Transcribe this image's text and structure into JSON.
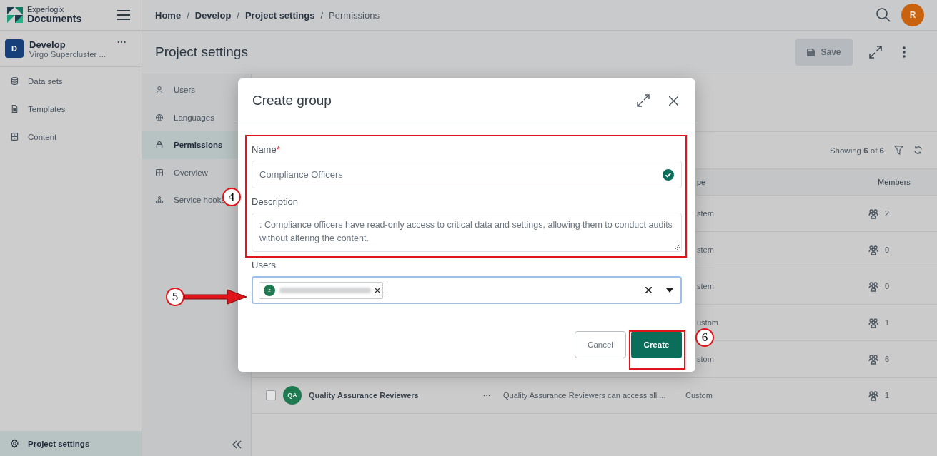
{
  "sidebar": {
    "brand_small": "Experlogix",
    "brand": "Documents",
    "project": {
      "initial": "D",
      "name": "Develop",
      "subtitle": "Virgo Supercluster ...",
      "more": "···"
    },
    "items": [
      {
        "label": "Data sets",
        "selected": false
      },
      {
        "label": "Templates",
        "selected": false
      },
      {
        "label": "Content",
        "selected": false
      }
    ],
    "footer": {
      "label": "Project settings",
      "selected": true
    }
  },
  "breadcrumb": {
    "items": [
      "Home",
      "Develop",
      "Project settings",
      "Permissions"
    ],
    "separator": "/"
  },
  "user_avatar": "R",
  "page_title": "Project settings",
  "save_button": {
    "label": "Save",
    "disabled": true
  },
  "settings_nav": [
    {
      "label": "Users",
      "selected": false
    },
    {
      "label": "Languages",
      "selected": false
    },
    {
      "label": "Permissions",
      "selected": true
    },
    {
      "label": "Overview",
      "selected": false
    },
    {
      "label": "Service hooks",
      "selected": false
    }
  ],
  "table": {
    "showing": "Showing **6** of **6**",
    "columns": [
      "pe",
      "Members"
    ],
    "rows": [
      {
        "kind": "partial",
        "type": "stem",
        "members": "2"
      },
      {
        "kind": "partial",
        "type": "stem",
        "members": "0"
      },
      {
        "kind": "partial",
        "type": "stem",
        "members": "0"
      },
      {
        "kind": "partial",
        "type": "ustom",
        "members": "1"
      },
      {
        "kind": "partial",
        "type": "stom",
        "members": "6"
      },
      {
        "kind": "full",
        "checked": false,
        "initials": "QA",
        "name": "Quality Assurance Reviewers",
        "more": "···",
        "description": "Quality Assurance Reviewers can access all ...",
        "type": "Custom",
        "members": "1"
      }
    ]
  },
  "dialog": {
    "title": "Create group",
    "fields": [
      {
        "kind": "text",
        "label": "Name",
        "required_mark": "*",
        "value": "Compliance Officers",
        "valid": true
      },
      {
        "kind": "textarea",
        "label": "Description",
        "value": ": Compliance officers have read-only access to critical data and settings, allowing them to conduct audits without altering the content."
      },
      {
        "kind": "select",
        "label": "Users",
        "focused": true,
        "chips": [
          {
            "initial": "z"
          }
        ]
      }
    ],
    "buttons": [
      {
        "label": "Cancel",
        "kind": "secondary"
      },
      {
        "label": "Create",
        "kind": "primary"
      }
    ]
  },
  "annotations": [
    {
      "label": "4"
    },
    {
      "label": "5"
    },
    {
      "label": "6"
    }
  ]
}
